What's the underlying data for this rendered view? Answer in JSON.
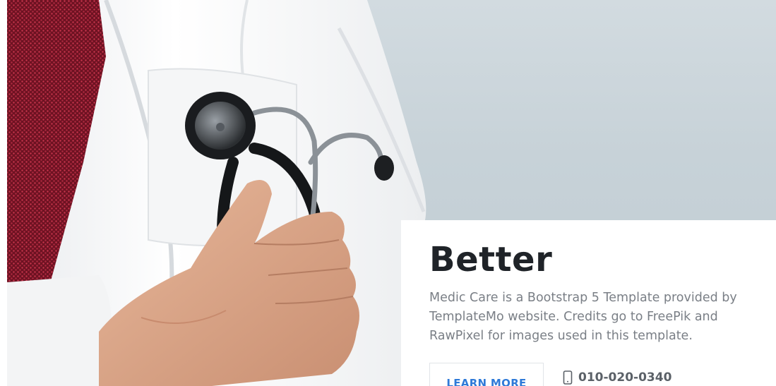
{
  "hero": {
    "title": "Better",
    "description": "Medic Care is a Bootstrap 5 Template provided by TemplateMo website. Credits go to FreePik and RawPixel for images used in this template.",
    "learn_more_label": "LEARN MORE",
    "phone_number": "010-020-0340",
    "phone_icon": "phone-icon",
    "accent_color": "#2f7ad8",
    "photo_subject": "doctor in white coat with red tie holding stethoscope"
  }
}
